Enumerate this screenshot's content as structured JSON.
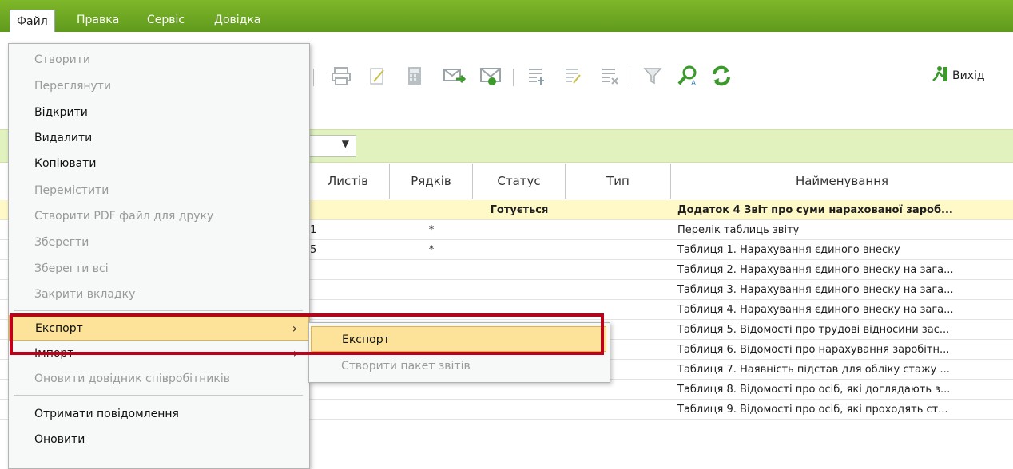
{
  "menubar": {
    "items": [
      "Файл",
      "Правка",
      "Сервіс",
      "Довідка"
    ]
  },
  "toolbar": {
    "icons": [
      "print-icon",
      "edit-icon",
      "calculator-icon",
      "mail-send-icon",
      "mail-receive-icon",
      "row-add-icon",
      "row-edit-icon",
      "row-delete-icon",
      "filter-icon",
      "search-icon",
      "refresh-icon"
    ],
    "exit_label": "Вихід"
  },
  "filter": {
    "combo_value": ""
  },
  "grid": {
    "columns": [
      "Листів",
      "Рядків",
      "Статус",
      "Тип",
      "Найменування"
    ],
    "rows": [
      {
        "lists": "",
        "rows": "",
        "status": "Готується",
        "type": "",
        "name": "Додаток 4 Звіт про суми нарахованої зароб..."
      },
      {
        "lists": "1",
        "rows": "*",
        "status": "",
        "type": "",
        "name": "Перелік таблиць звіту"
      },
      {
        "lists": "5",
        "rows": "*",
        "status": "",
        "type": "",
        "name": "Таблиця 1. Нарахування єдиного внеску"
      },
      {
        "lists": "",
        "rows": "",
        "status": "",
        "type": "",
        "name": "Таблиця 2. Нарахування єдиного внеску на зага..."
      },
      {
        "lists": "",
        "rows": "",
        "status": "",
        "type": "",
        "name": "Таблиця 3. Нарахування єдиного внеску на зага..."
      },
      {
        "lists": "",
        "rows": "",
        "status": "",
        "type": "",
        "name": "Таблиця 4. Нарахування єдиного внеску на зага..."
      },
      {
        "lists": "",
        "rows": "",
        "status": "",
        "type": "",
        "name": "Таблиця 5. Відомості про трудові відносини зас..."
      },
      {
        "lists": "",
        "rows": "",
        "status": "",
        "type": "",
        "name": "Таблиця 6. Відомості про нарахування заробітн..."
      },
      {
        "lists": "",
        "rows": "",
        "status": "",
        "type": "",
        "name": "Таблиця 7. Наявність підстав для обліку стажу ..."
      },
      {
        "lists": "",
        "rows": "",
        "status": "",
        "type": "",
        "name": "Таблиця 8. Відомості про осіб, які доглядають з..."
      },
      {
        "lists": "",
        "rows": "",
        "status": "",
        "type": "",
        "name": "Таблиця 9. Відомості про осіб, які проходять ст..."
      }
    ]
  },
  "file_menu": {
    "items": [
      {
        "label": "Створити",
        "enabled": false
      },
      {
        "label": "Переглянути",
        "enabled": false
      },
      {
        "label": "Відкрити",
        "enabled": true
      },
      {
        "label": "Видалити",
        "enabled": true
      },
      {
        "label": "Копіювати",
        "enabled": true
      },
      {
        "label": "Перемістити",
        "enabled": false
      },
      {
        "label": "Створити PDF файл для друку",
        "enabled": false
      },
      {
        "label": "Зберегти",
        "enabled": false
      },
      {
        "label": "Зберегти всі",
        "enabled": false
      },
      {
        "label": "Закрити вкладку",
        "enabled": false
      },
      {
        "label": "Експорт",
        "enabled": true,
        "submenu": true
      },
      {
        "label": "Імпорт",
        "enabled": true,
        "submenu": true
      },
      {
        "label": "Оновити довідник співробітників",
        "enabled": false
      },
      {
        "label": "Отримати повідомлення",
        "enabled": true
      },
      {
        "label": "Оновити",
        "enabled": true
      }
    ]
  },
  "export_submenu": {
    "items": [
      {
        "label": "Експорт",
        "enabled": true
      },
      {
        "label": "Створити пакет звітів",
        "enabled": false
      }
    ]
  },
  "colors": {
    "menubar": "#6aa620",
    "highlight": "#fde29a",
    "callout": "#c00018",
    "filterbar": "#e1f2bf"
  }
}
